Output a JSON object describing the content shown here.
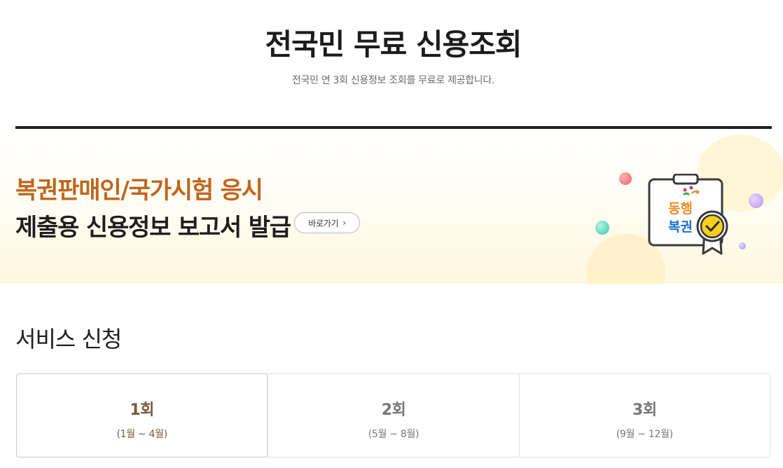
{
  "header": {
    "title": "전국민 무료 신용조회",
    "subtitle": "전국민 연 3회 신용정보 조회를 무료로 제공합니다."
  },
  "banner": {
    "line1": "복권판매인/국가시험 응시",
    "line2": "제출용 신용정보 보고서 발급",
    "go_label": "바로가기",
    "go_icon": "chevron-right-icon",
    "badge_logo_top": "동행",
    "badge_logo_bottom": "복권",
    "colors": {
      "accent": "#c0651b",
      "badge_check": "#f7cf1d",
      "logo_orange": "#f08c2e",
      "logo_blue": "#1d6fce"
    }
  },
  "service": {
    "title": "서비스 신청",
    "rounds": [
      {
        "name": "1회",
        "period": "(1월 ~ 4월)",
        "active": true
      },
      {
        "name": "2회",
        "period": "(5월 ~ 8월)",
        "active": false
      },
      {
        "name": "3회",
        "period": "(9월 ~ 12월)",
        "active": false
      }
    ]
  }
}
